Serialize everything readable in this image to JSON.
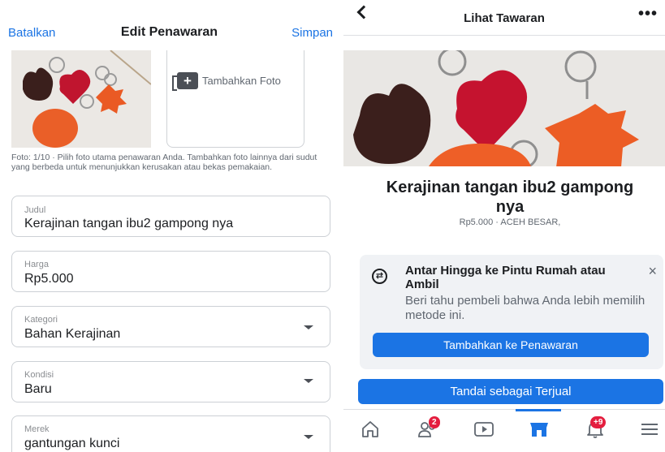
{
  "edit_screen": {
    "header": {
      "cancel_label": "Batalkan",
      "title": "Edit Penawaran",
      "save_label": "Simpan"
    },
    "photos": {
      "add_photo_label": "Tambahkan Foto",
      "note": "Foto: 1/10 · Pilih foto utama penawaran Anda. Tambahkan foto lainnya dari sudut yang berbeda untuk menunjukkan kerusakan atau bekas pemakaian."
    },
    "fields": [
      {
        "label": "Judul",
        "value": "Kerajinan tangan ibu2 gampong nya"
      },
      {
        "label": "Harga",
        "value": "Rp5.000"
      },
      {
        "label": "Kategori",
        "value": "Bahan Kerajinan"
      },
      {
        "label": "Kondisi",
        "value": "Baru"
      },
      {
        "label": "Merek",
        "value": "gantungan kunci"
      }
    ]
  },
  "view_screen": {
    "header": {
      "title": "Lihat Tawaran",
      "more_icon": "•••"
    },
    "product": {
      "title": "Kerajinan tangan ibu2 gampong nya",
      "meta": "Rp5.000 · ACEH BESAR,"
    },
    "delivery_card": {
      "title": "Antar Hingga ke Pintu Rumah atau Ambil",
      "description": "Beri tahu pembeli bahwa Anda lebih memilih metode ini.",
      "button_label": "Tambahkan ke Penawaran",
      "close_icon": "×"
    },
    "sold_button_label": "Tandai sebagai Terjual",
    "tabbar": {
      "friends_badge": "2",
      "notifications_badge": "+9",
      "active_tab": "marketplace"
    }
  },
  "colors": {
    "accent": "#1b74e4",
    "badge": "#e41e3f"
  }
}
